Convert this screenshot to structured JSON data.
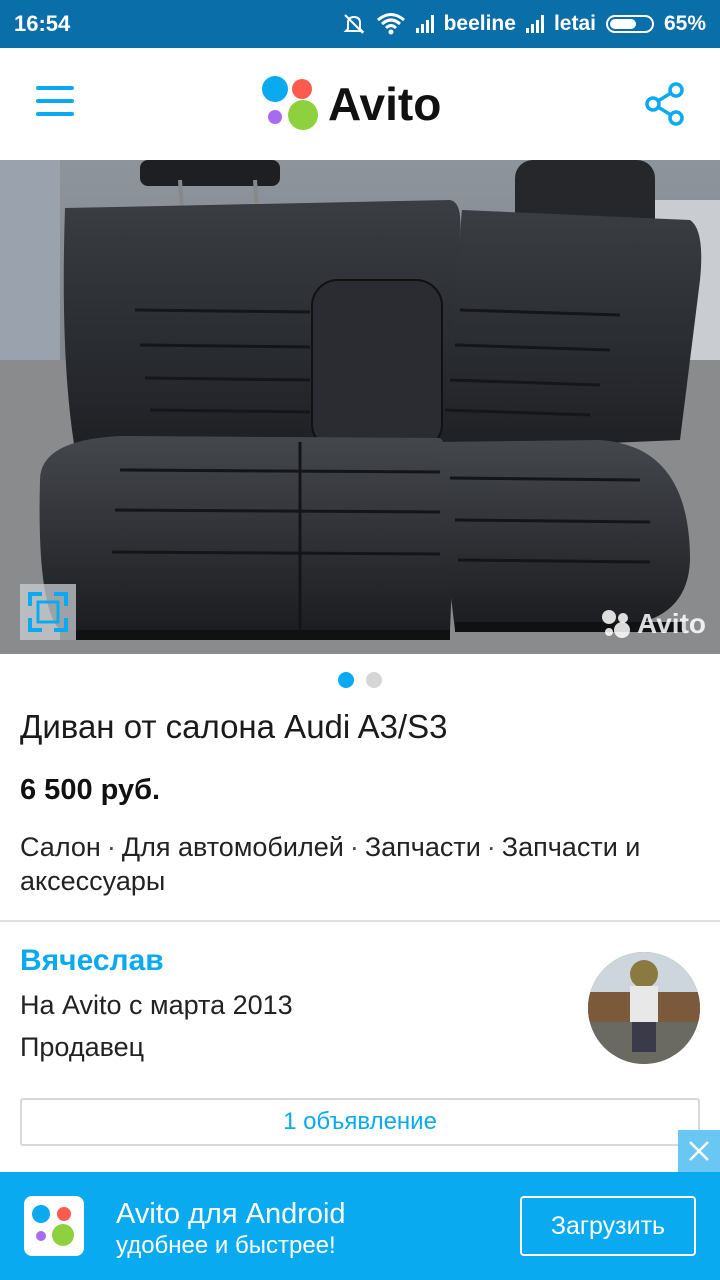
{
  "status_bar": {
    "time": "16:54",
    "carrier1": "beeline",
    "carrier2": "letai",
    "battery": "65%",
    "icons": [
      "mute-bell-icon",
      "wifi-icon",
      "signal-icon",
      "battery-icon"
    ]
  },
  "header": {
    "logo_text": "Avito",
    "menu_icon": "hamburger-menu-icon",
    "share_icon": "share-icon"
  },
  "gallery": {
    "watermark": "Avito",
    "image_count": 2,
    "active_index": 0
  },
  "listing": {
    "title": "Диван от салона Audi A3/S3",
    "price": "6 500 руб.",
    "categories": [
      "Салон",
      "Для автомобилей",
      "Запчасти",
      "Запчасти и аксессуары"
    ],
    "separator": "·"
  },
  "seller": {
    "name": "Вячеслав",
    "since": "На Avito с марта 2013",
    "role": "Продавец",
    "ads_button": "1 объявление"
  },
  "banner": {
    "line1": "Avito для Android",
    "line2": "удобнее и быстрее!",
    "button": "Загрузить"
  },
  "colors": {
    "brand_blue": "#0aaaf0",
    "status_bar": "#0a6ea8",
    "logo_dot_blue": "#0aaaf0",
    "logo_dot_red": "#ff5a4e",
    "logo_dot_purple": "#a86bf0",
    "logo_dot_green": "#8ed13f"
  }
}
